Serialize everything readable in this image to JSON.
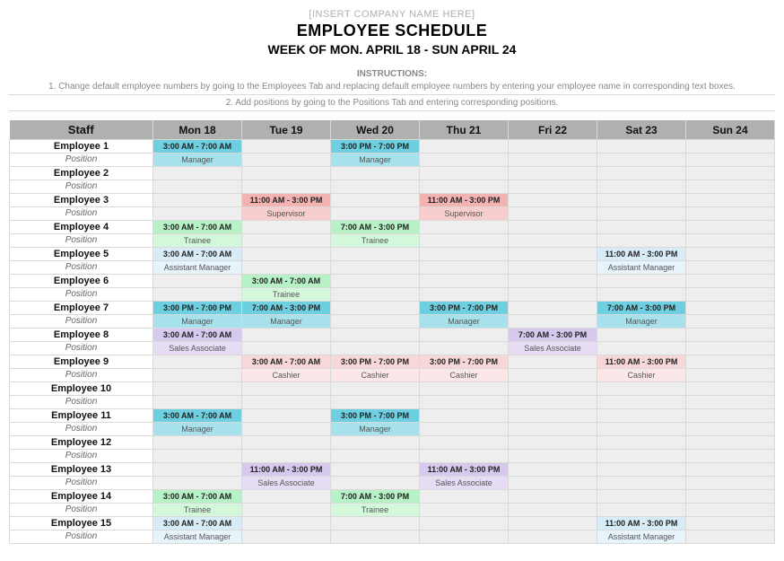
{
  "header": {
    "company_placeholder": "[INSERT COMPANY NAME HERE]",
    "title": "EMPLOYEE SCHEDULE",
    "week_line": "WEEK OF MON. APRIL 18 - SUN APRIL 24",
    "instructions_label": "INSTRUCTIONS:",
    "instruction1": "1. Change default employee numbers by going to the Employees Tab and replacing default employee numbers by entering your employee name in corresponding text boxes.",
    "instruction2": "2. Add positions by going to the Positions Tab and entering corresponding positions."
  },
  "columns": {
    "staff": "Staff",
    "days": [
      "Mon 18",
      "Tue 19",
      "Wed 20",
      "Thu 21",
      "Fri 22",
      "Sat 23",
      "Sun 24"
    ]
  },
  "position_label": "Position",
  "positions": {
    "manager": "Manager",
    "supervisor": "Supervisor",
    "trainee": "Trainee",
    "assistant": "Assistant Manager",
    "sales": "Sales Associate",
    "cashier": "Cashier"
  },
  "employees": [
    {
      "name": "Employee 1",
      "shifts": [
        {
          "d": 0,
          "time": "3:00 AM - 7:00 AM",
          "pos": "manager"
        },
        {
          "d": 2,
          "time": "3:00 PM - 7:00 PM",
          "pos": "manager"
        }
      ]
    },
    {
      "name": "Employee 2",
      "shifts": []
    },
    {
      "name": "Employee 3",
      "shifts": [
        {
          "d": 1,
          "time": "11:00 AM - 3:00 PM",
          "pos": "supervisor"
        },
        {
          "d": 3,
          "time": "11:00 AM - 3:00 PM",
          "pos": "supervisor"
        }
      ]
    },
    {
      "name": "Employee 4",
      "shifts": [
        {
          "d": 0,
          "time": "3:00 AM - 7:00 AM",
          "pos": "trainee"
        },
        {
          "d": 2,
          "time": "7:00 AM - 3:00 PM",
          "pos": "trainee"
        }
      ]
    },
    {
      "name": "Employee 5",
      "shifts": [
        {
          "d": 0,
          "time": "3:00 AM - 7:00 AM",
          "pos": "assistant"
        },
        {
          "d": 5,
          "time": "11:00 AM - 3:00 PM",
          "pos": "assistant"
        }
      ]
    },
    {
      "name": "Employee 6",
      "shifts": [
        {
          "d": 1,
          "time": "3:00 AM - 7:00 AM",
          "pos": "trainee"
        }
      ]
    },
    {
      "name": "Employee 7",
      "shifts": [
        {
          "d": 0,
          "time": "3:00 PM - 7:00 PM",
          "pos": "manager"
        },
        {
          "d": 1,
          "time": "7:00 AM - 3:00 PM",
          "pos": "manager"
        },
        {
          "d": 3,
          "time": "3:00 PM - 7:00 PM",
          "pos": "manager"
        },
        {
          "d": 5,
          "time": "7:00 AM - 3:00 PM",
          "pos": "manager"
        }
      ]
    },
    {
      "name": "Employee 8",
      "shifts": [
        {
          "d": 0,
          "time": "3:00 AM - 7:00 AM",
          "pos": "sales"
        },
        {
          "d": 4,
          "time": "7:00 AM - 3:00 PM",
          "pos": "sales"
        }
      ]
    },
    {
      "name": "Employee 9",
      "shifts": [
        {
          "d": 1,
          "time": "3:00 AM - 7:00 AM",
          "pos": "cashier"
        },
        {
          "d": 2,
          "time": "3:00 PM - 7:00 PM",
          "pos": "cashier"
        },
        {
          "d": 3,
          "time": "3:00 PM - 7:00 PM",
          "pos": "cashier"
        },
        {
          "d": 5,
          "time": "11:00 AM - 3:00 PM",
          "pos": "cashier"
        }
      ]
    },
    {
      "name": "Employee 10",
      "shifts": []
    },
    {
      "name": "Employee 11",
      "shifts": [
        {
          "d": 0,
          "time": "3:00 AM - 7:00 AM",
          "pos": "manager"
        },
        {
          "d": 2,
          "time": "3:00 PM - 7:00 PM",
          "pos": "manager"
        }
      ]
    },
    {
      "name": "Employee 12",
      "shifts": []
    },
    {
      "name": "Employee 13",
      "shifts": [
        {
          "d": 1,
          "time": "11:00 AM - 3:00 PM",
          "pos": "sales"
        },
        {
          "d": 3,
          "time": "11:00 AM - 3:00 PM",
          "pos": "sales"
        }
      ]
    },
    {
      "name": "Employee 14",
      "shifts": [
        {
          "d": 0,
          "time": "3:00 AM - 7:00 AM",
          "pos": "trainee"
        },
        {
          "d": 2,
          "time": "7:00 AM - 3:00 PM",
          "pos": "trainee"
        }
      ]
    },
    {
      "name": "Employee 15",
      "shifts": [
        {
          "d": 0,
          "time": "3:00 AM - 7:00 AM",
          "pos": "assistant"
        },
        {
          "d": 5,
          "time": "11:00 AM - 3:00 PM",
          "pos": "assistant"
        }
      ]
    }
  ]
}
